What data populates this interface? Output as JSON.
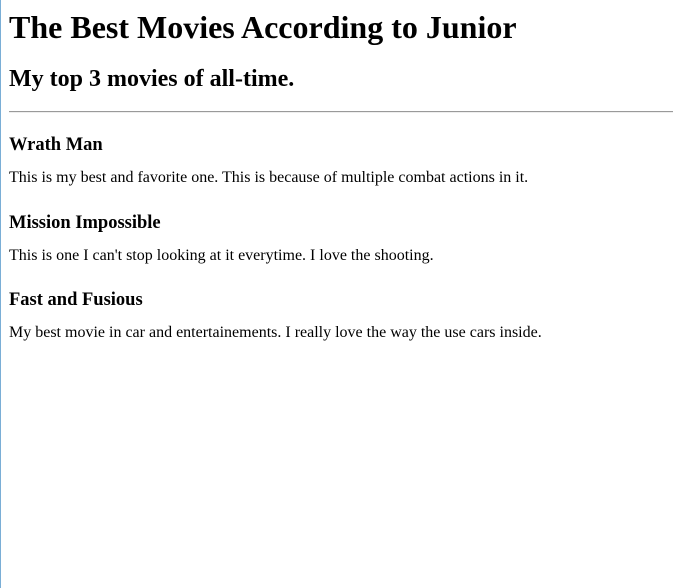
{
  "page": {
    "title": "The Best Movies According to Junior",
    "subtitle": "My top 3 movies of all-time."
  },
  "movies": [
    {
      "name": "Wrath Man",
      "description": "This is my best and favorite one. This is because of multiple combat actions in it."
    },
    {
      "name": "Mission Impossible",
      "description": "This is one I can't stop looking at it everytime. I love the shooting."
    },
    {
      "name": "Fast and Fusious",
      "description": "My best movie in car and entertainements. I really love the way the use cars inside."
    }
  ]
}
